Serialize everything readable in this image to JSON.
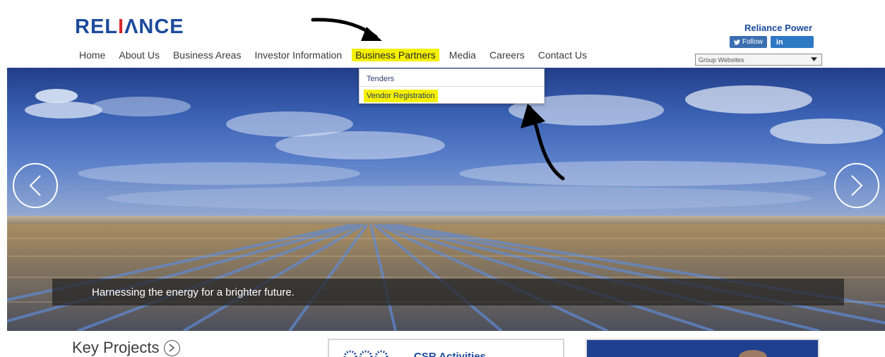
{
  "header": {
    "logo": {
      "part1": "REL",
      "accent": "I",
      "part2": "ΛNCE"
    },
    "brand_title": "Reliance Power",
    "social": {
      "follow_label": "Follow",
      "linkedin_label": "in"
    },
    "group_websites": {
      "selected": "Group Websites",
      "icon": "chevron-down-icon"
    }
  },
  "nav": {
    "items": [
      {
        "label": "Home"
      },
      {
        "label": "About Us"
      },
      {
        "label": "Business Areas"
      },
      {
        "label": "Investor Information"
      },
      {
        "label": "Business Partners"
      },
      {
        "label": "Media"
      },
      {
        "label": "Careers"
      },
      {
        "label": "Contact Us"
      }
    ]
  },
  "dropdown": {
    "items": [
      {
        "label": "Tenders"
      },
      {
        "label": "Vendor Registration"
      }
    ]
  },
  "hero": {
    "caption": "Harnessing the energy for a brighter future.",
    "prev_icon": "chevron-left-icon",
    "next_icon": "chevron-right-icon"
  },
  "bottom": {
    "key_projects": "Key Projects",
    "csr_title": "CSR Activities"
  },
  "colors": {
    "brand_blue": "#1c4a9c",
    "logo_accent": "#d8262a",
    "highlight": "#f4f000",
    "caption_bg": "#232323"
  }
}
